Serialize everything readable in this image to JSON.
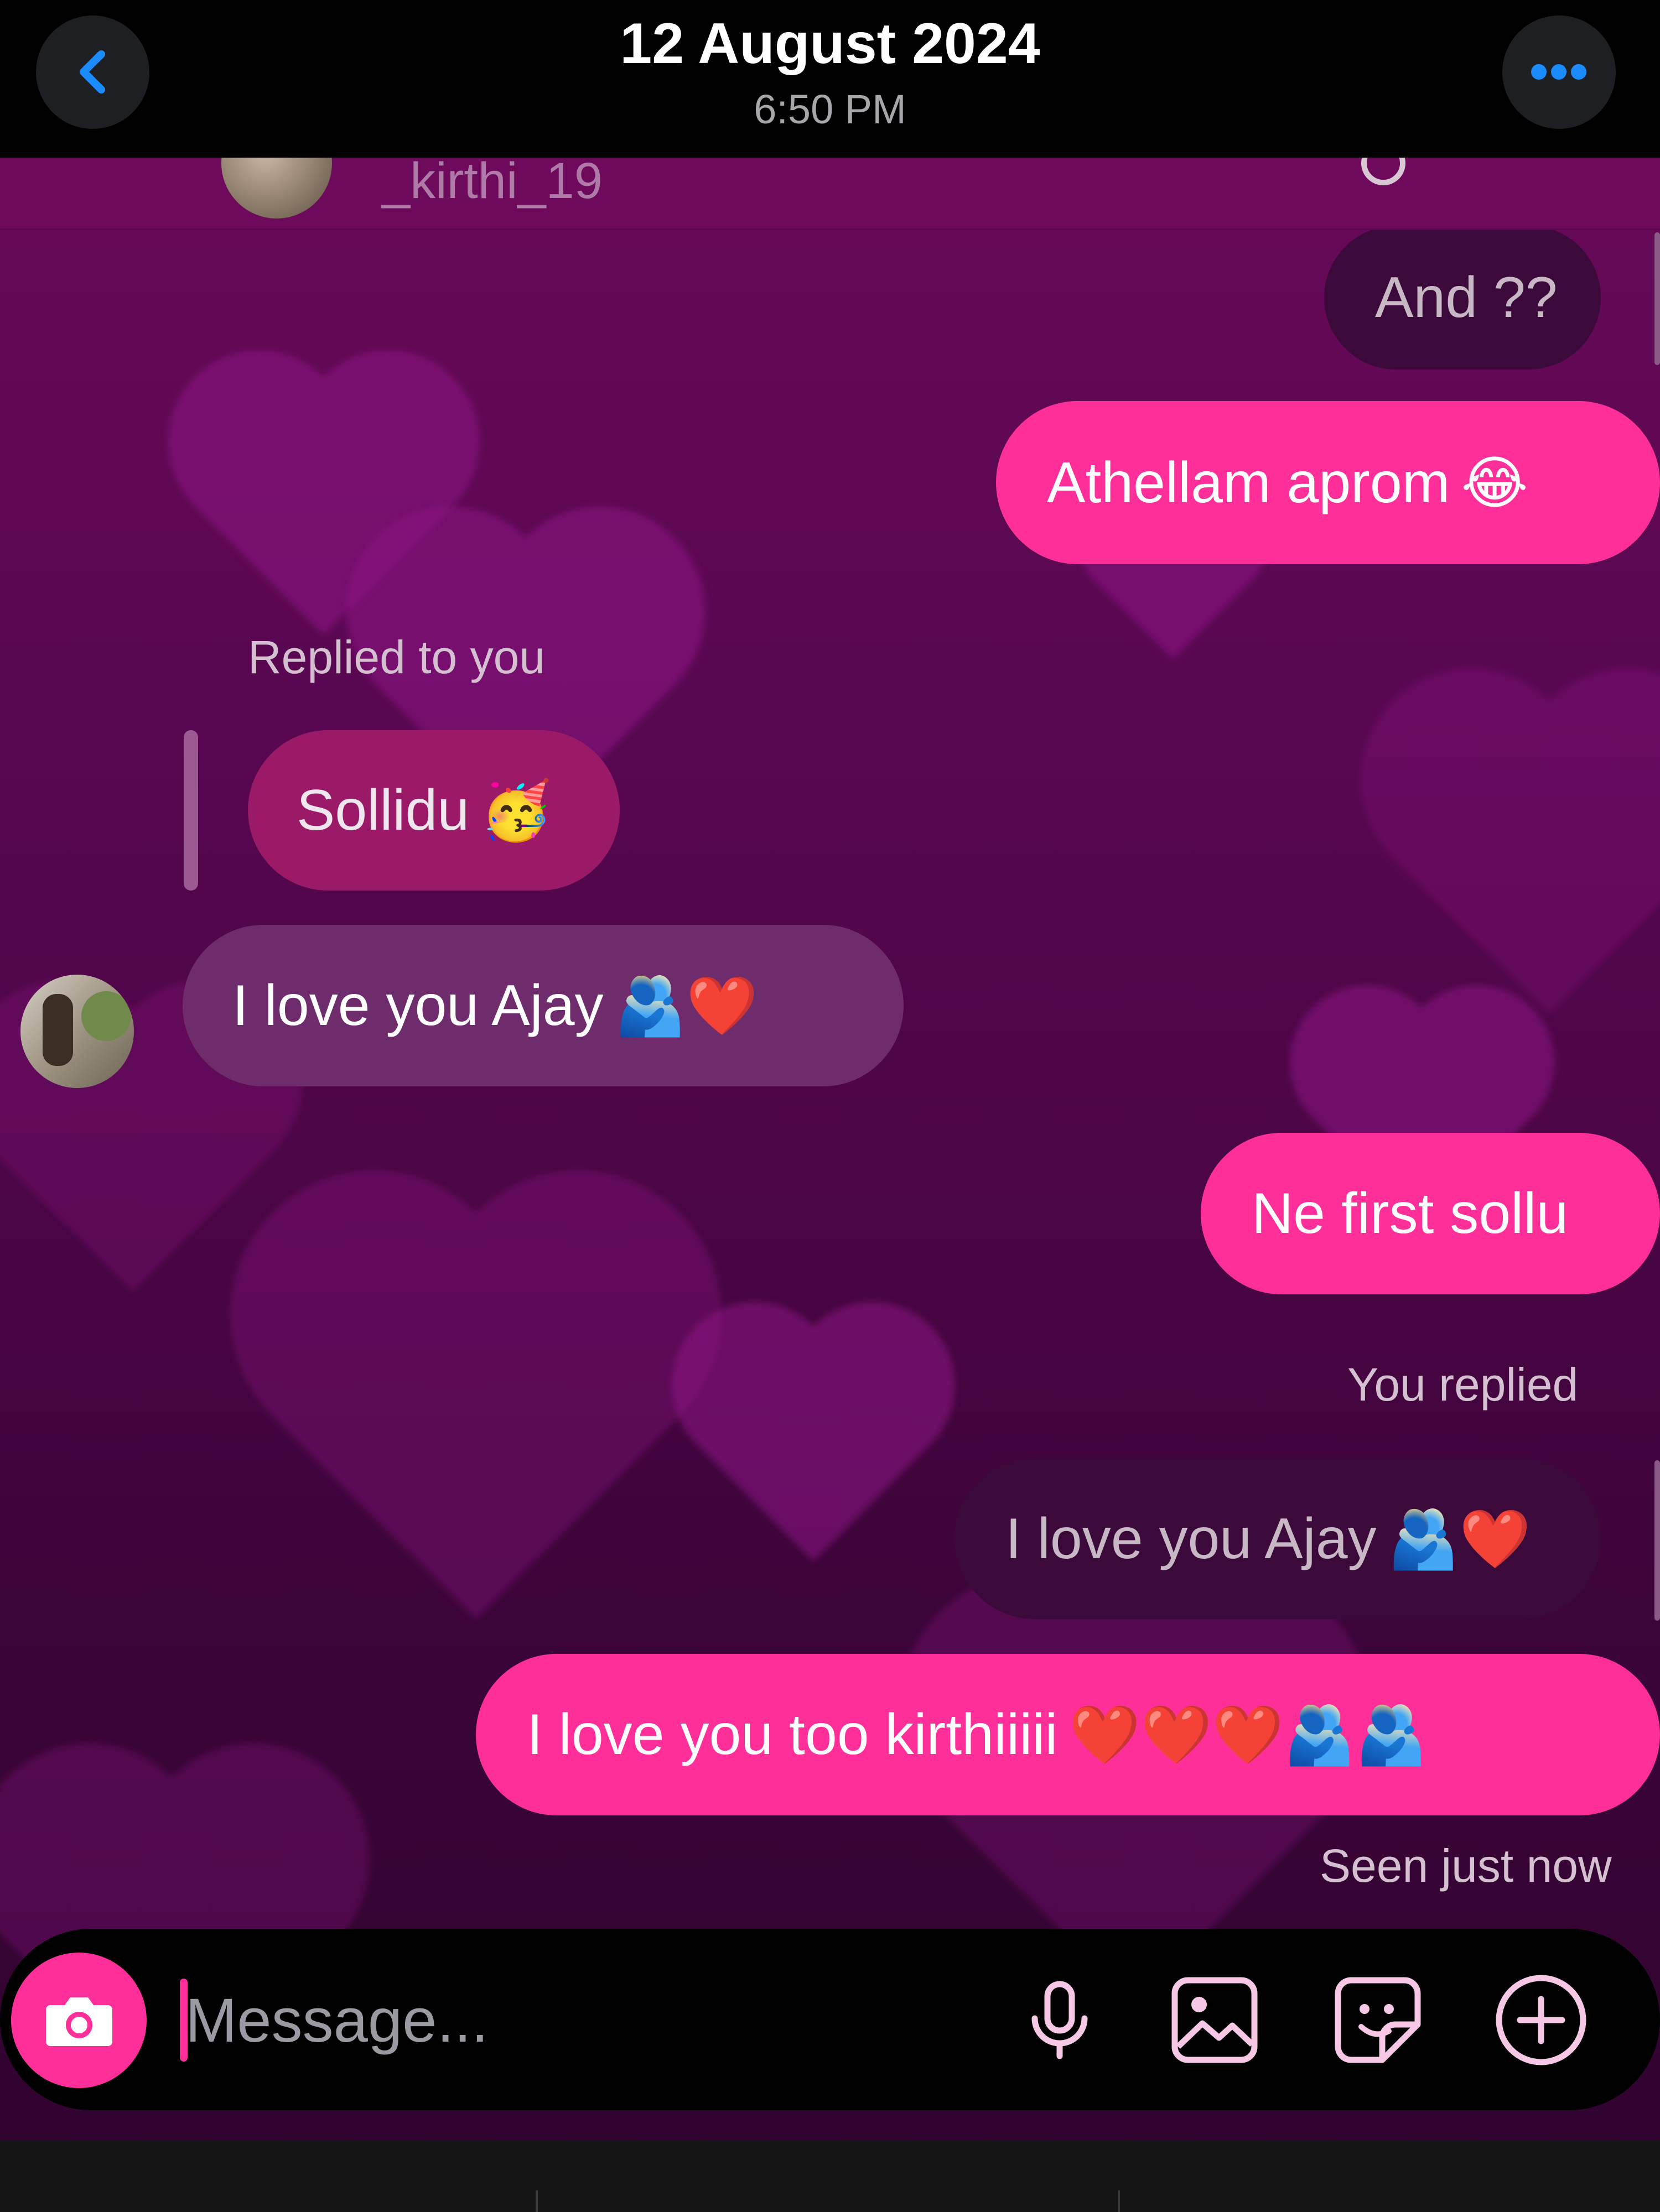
{
  "header": {
    "date": "12 August 2024",
    "time": "6:50 PM"
  },
  "profile": {
    "username": "_kirthi_19"
  },
  "messages": {
    "and_q": "And ??",
    "athellam": "Athellam aprom",
    "athellam_emoji": "😂",
    "replied_label": "Replied to you",
    "sollidu": "Sollidu",
    "sollidu_emoji": "🥳",
    "love_ajay": "I love you Ajay",
    "love_ajay_emoji": "🫂❤️",
    "ne_first": "Ne first sollu",
    "you_replied_label": "You replied",
    "quote_text": "I love you Ajay",
    "quote_emoji": "🫂❤️",
    "love_too": "I love you too kirthiiiii",
    "love_too_emoji": "❤️❤️❤️🫂🫂",
    "seen": "Seen just now"
  },
  "composer": {
    "placeholder": "Message..."
  },
  "colors": {
    "accent": "#ff2f9a",
    "back_arrow": "#1a8cff",
    "icon": "#f7c8e6"
  },
  "icons": {
    "back": "chevron-left-icon",
    "more": "more-horizontal-icon",
    "camera": "camera-icon",
    "mic": "microphone-icon",
    "gallery": "image-icon",
    "sticker": "sticker-icon",
    "plus": "plus-circle-icon"
  }
}
